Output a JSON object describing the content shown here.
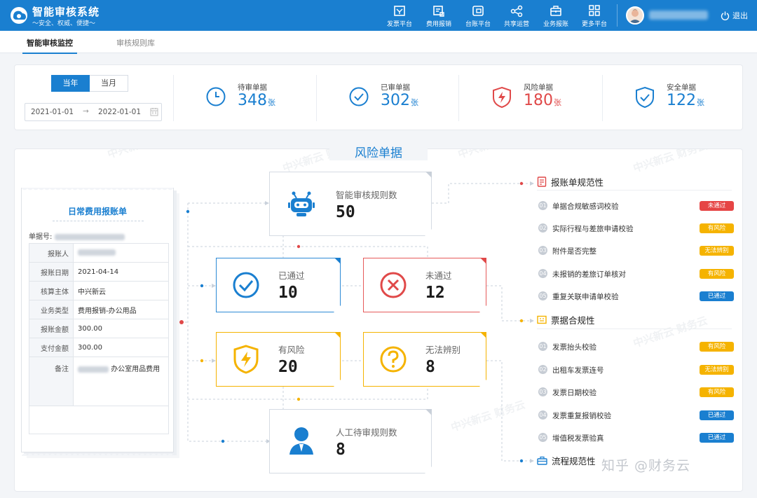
{
  "header": {
    "app_title": "智能审核系统",
    "app_subtitle": "～安全、权威、便捷～",
    "nav": [
      {
        "label": "发票平台",
        "icon": "invoice-icon"
      },
      {
        "label": "费用报销",
        "icon": "expense-icon"
      },
      {
        "label": "台账平台",
        "icon": "ledger-icon"
      },
      {
        "label": "共享运营",
        "icon": "share-icon"
      },
      {
        "label": "业务报账",
        "icon": "briefcase-icon"
      },
      {
        "label": "更多平台",
        "icon": "grid-icon"
      }
    ],
    "logout_label": "退出"
  },
  "tabs": [
    {
      "label": "智能审核监控",
      "active": true
    },
    {
      "label": "审核规则库",
      "active": false
    }
  ],
  "filters": {
    "period_options": [
      "当年",
      "当月"
    ],
    "selected_period": "当年",
    "date_start": "2021-01-01",
    "date_end": "2022-01-01",
    "range_separator": "→"
  },
  "stats": [
    {
      "label": "待审单据",
      "value": "348",
      "unit": "张",
      "color": "#1a7fd0",
      "icon": "clock-icon"
    },
    {
      "label": "已审单据",
      "value": "302",
      "unit": "张",
      "color": "#1a7fd0",
      "icon": "check-circle-icon"
    },
    {
      "label": "风险单据",
      "value": "180",
      "unit": "张",
      "color": "#e04949",
      "icon": "shield-lightning-icon"
    },
    {
      "label": "安全单据",
      "value": "122",
      "unit": "张",
      "color": "#1a7fd0",
      "icon": "shield-check-icon"
    }
  ],
  "panel_title": "风险单据",
  "receipt": {
    "title": "日常费用报账单",
    "number_label": "单据号:",
    "fields": [
      {
        "key": "报账人",
        "value": ""
      },
      {
        "key": "报账日期",
        "value": "2021-04-14"
      },
      {
        "key": "核算主体",
        "value": "中兴新云"
      },
      {
        "key": "业务类型",
        "value": "费用报销-办公用品"
      },
      {
        "key": "报账金额",
        "value": "300.00"
      },
      {
        "key": "支付金额",
        "value": "300.00"
      },
      {
        "key": "备注",
        "value": "办公室用品费用"
      }
    ]
  },
  "hub": {
    "smart_rules": {
      "label": "智能审核规则数",
      "value": "50"
    },
    "passed": {
      "label": "已通过",
      "value": "10"
    },
    "failed": {
      "label": "未通过",
      "value": "12"
    },
    "risky": {
      "label": "有风险",
      "value": "20"
    },
    "unknown": {
      "label": "无法辨别",
      "value": "8"
    },
    "manual_rules": {
      "label": "人工待审规则数",
      "value": "8"
    }
  },
  "status_colors": {
    "未通过": "#e64545",
    "有风险": "#f5b300",
    "无法辨别": "#f5b300",
    "已通过": "#1a7fd0"
  },
  "rule_groups": [
    {
      "title": "报账单规范性",
      "icon": "document-icon",
      "rules": [
        {
          "no": "01",
          "text": "单据合规敏感词校验",
          "status": "未通过"
        },
        {
          "no": "02",
          "text": "实际行程与差旅申请校验",
          "status": "有风险"
        },
        {
          "no": "03",
          "text": "附件是否完整",
          "status": "无法辨别"
        },
        {
          "no": "04",
          "text": "未报销的差旅订单核对",
          "status": "有风险"
        },
        {
          "no": "05",
          "text": "重复关联申请单校验",
          "status": "已通过"
        }
      ]
    },
    {
      "title": "票据合规性",
      "icon": "ticket-icon",
      "rules": [
        {
          "no": "01",
          "text": "发票抬头校验",
          "status": "有风险"
        },
        {
          "no": "02",
          "text": "出租车发票连号",
          "status": "无法辨别"
        },
        {
          "no": "03",
          "text": "发票日期校验",
          "status": "有风险"
        },
        {
          "no": "04",
          "text": "发票重复报销校验",
          "status": "已通过"
        },
        {
          "no": "05",
          "text": "增值税发票验真",
          "status": "已通过"
        }
      ]
    },
    {
      "title": "流程规范性",
      "icon": "toolbox-icon",
      "rules": []
    }
  ],
  "footer_watermark": "知乎 @财务云"
}
